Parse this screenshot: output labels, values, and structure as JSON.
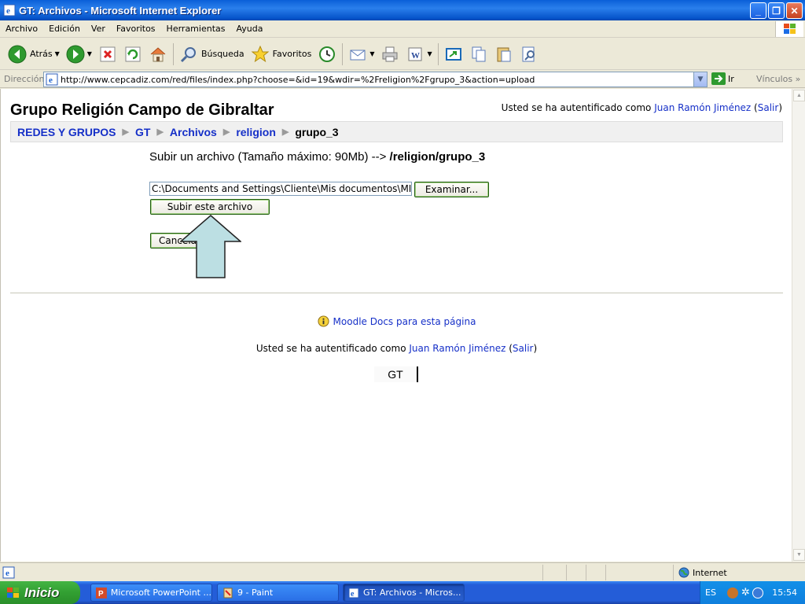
{
  "window": {
    "title": "GT: Archivos - Microsoft Internet Explorer"
  },
  "menu": [
    "Archivo",
    "Edición",
    "Ver",
    "Favoritos",
    "Herramientas",
    "Ayuda"
  ],
  "toolbar": {
    "back": "Atrás",
    "search": "Búsqueda",
    "favorites": "Favoritos"
  },
  "address": {
    "label": "Dirección",
    "url": "http://www.cepcadiz.com/red/files/index.php?choose=&id=19&wdir=%2Freligion%2Fgrupo_3&action=upload",
    "go": "Ir",
    "links": "Vínculos"
  },
  "page": {
    "site_title": "Grupo Religión Campo de Gibraltar",
    "login_prefix": "Usted se ha autentificado como ",
    "user": "Juan Ramón Jiménez",
    "logout": "Salir",
    "breadcrumb": [
      "REDES Y GRUPOS",
      "GT",
      "Archivos",
      "religion"
    ],
    "breadcrumb_current": "grupo_3",
    "upload_label": "Subir un archivo (Tamaño máximo: 90Mb) -->",
    "upload_path": "/religion/grupo_3",
    "file_value": "C:\\Documents and Settings\\Cliente\\Mis documentos\\MIS",
    "browse": "Examinar...",
    "submit": "Subir este archivo",
    "cancel": "Cancelar",
    "docs_link": "Moodle Docs para esta página",
    "footer_course": "GT"
  },
  "status": {
    "zone": "Internet"
  },
  "taskbar": {
    "start": "Inicio",
    "tasks": [
      "Microsoft PowerPoint ...",
      "9 - Paint",
      "GT: Archivos - Micros..."
    ],
    "lang": "ES",
    "clock": "15:54"
  },
  "colors": {
    "link": "#1630c8",
    "titlebar": "#0a5fd8",
    "taskbar": "#245dd8",
    "start": "#329f32"
  }
}
